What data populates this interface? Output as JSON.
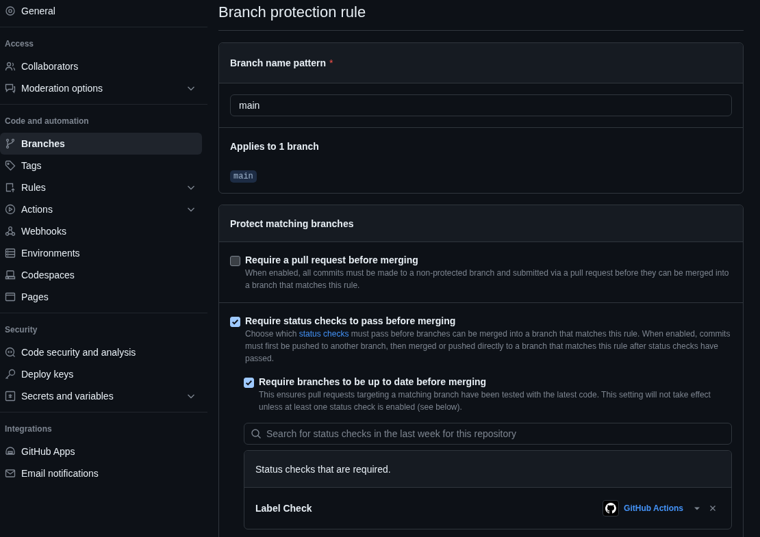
{
  "sidebar": {
    "sections": [
      {
        "items": [
          {
            "label": "General",
            "selected": false,
            "has_submenu": false
          }
        ]
      },
      {
        "heading": "Access",
        "items": [
          {
            "label": "Collaborators",
            "selected": false,
            "has_submenu": false
          },
          {
            "label": "Moderation options",
            "selected": false,
            "has_submenu": true
          }
        ]
      },
      {
        "heading": "Code and automation",
        "items": [
          {
            "label": "Branches",
            "selected": true,
            "has_submenu": false
          },
          {
            "label": "Tags",
            "selected": false,
            "has_submenu": false
          },
          {
            "label": "Rules",
            "selected": false,
            "has_submenu": true
          },
          {
            "label": "Actions",
            "selected": false,
            "has_submenu": true
          },
          {
            "label": "Webhooks",
            "selected": false,
            "has_submenu": false
          },
          {
            "label": "Environments",
            "selected": false,
            "has_submenu": false
          },
          {
            "label": "Codespaces",
            "selected": false,
            "has_submenu": false
          },
          {
            "label": "Pages",
            "selected": false,
            "has_submenu": false
          }
        ]
      },
      {
        "heading": "Security",
        "items": [
          {
            "label": "Code security and analysis",
            "selected": false,
            "has_submenu": false
          },
          {
            "label": "Deploy keys",
            "selected": false,
            "has_submenu": false
          },
          {
            "label": "Secrets and variables",
            "selected": false,
            "has_submenu": true
          }
        ]
      },
      {
        "heading": "Integrations",
        "items": [
          {
            "label": "GitHub Apps",
            "selected": false,
            "has_submenu": false
          },
          {
            "label": "Email notifications",
            "selected": false,
            "has_submenu": false
          }
        ]
      }
    ]
  },
  "page_title": "Branch protection rule",
  "pattern_card": {
    "label": "Branch name pattern",
    "required_mark": "*",
    "value": "main",
    "applies_label": "Applies to 1 branch",
    "branches": [
      "main"
    ]
  },
  "protect_card": {
    "title": "Protect matching branches",
    "options": [
      {
        "label": "Require a pull request before merging",
        "checked": false,
        "description": "When enabled, all commits must be made to a non-protected branch and submitted via a pull request before they can be merged into a branch that matches this rule."
      },
      {
        "label": "Require status checks to pass before merging",
        "checked": true,
        "description_before": "Choose which ",
        "description_link": "status checks",
        "description_after": " must pass before branches can be merged into a branch that matches this rule. When enabled, commits must first be pushed to another branch, then merged or pushed directly to a branch that matches this rule after status checks have passed.",
        "sub_option": {
          "label": "Require branches to be up to date before merging",
          "checked": true,
          "description": "This ensures pull requests targeting a matching branch have been tested with the latest code. This setting will not take effect unless at least one status check is enabled (see below)."
        },
        "search": {
          "placeholder": "Search for status checks in the last week for this repository"
        },
        "required_checks": {
          "title": "Status checks that are required.",
          "rows": [
            {
              "name": "Label Check",
              "source": "GitHub Actions"
            }
          ]
        }
      }
    ]
  }
}
